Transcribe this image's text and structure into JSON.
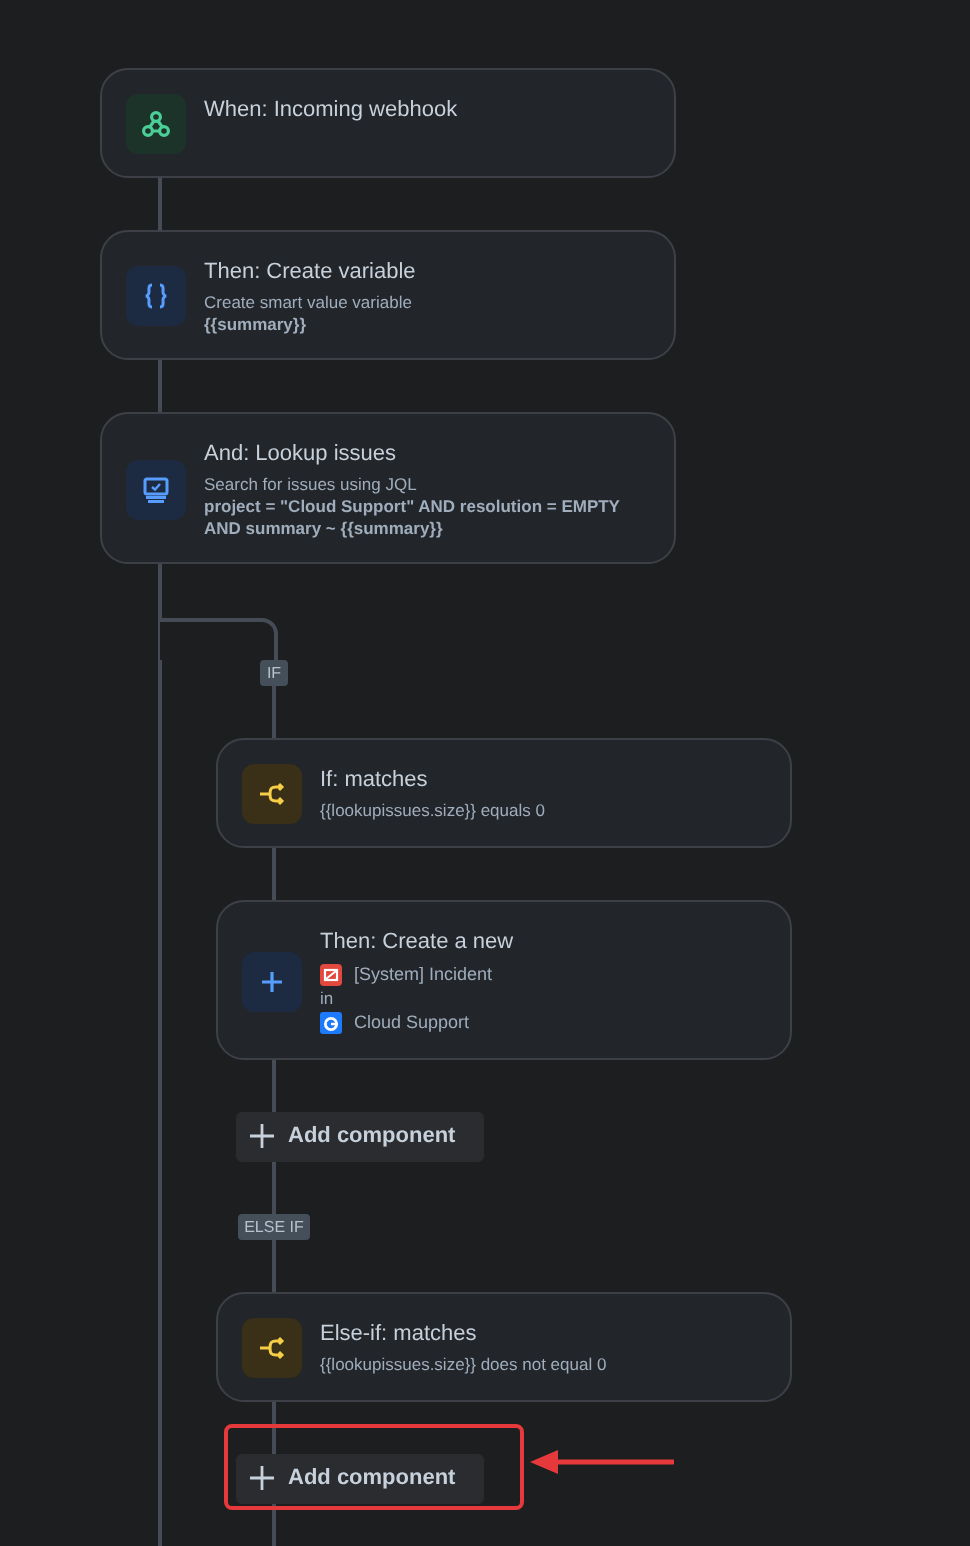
{
  "steps": [
    {
      "kind": "trigger",
      "title": "When: Incoming webhook"
    },
    {
      "kind": "variable",
      "title": "Then: Create variable",
      "lines": [
        {
          "kind": "plain",
          "text": "Create smart value variable"
        },
        {
          "kind": "value",
          "text": "{{summary}}"
        }
      ]
    },
    {
      "kind": "lookup",
      "title": "And: Lookup issues",
      "lines": [
        {
          "kind": "plain",
          "text": "Search for issues using JQL"
        },
        {
          "kind": "value",
          "text": "project = \"Cloud Support\" AND resolution = EMPTY AND summary ~ {{summary}}"
        }
      ]
    }
  ],
  "branch": [
    {
      "kind": "tag",
      "text": "IF"
    },
    {
      "kind": "condition",
      "title": "If: matches",
      "lines": [
        {
          "kind": "plain",
          "text": "{{lookupissues.size}} equals 0"
        }
      ]
    },
    {
      "kind": "create",
      "title": "Then: Create a new",
      "lines": [
        {
          "kind": "issue-type",
          "text": "[System] Incident"
        },
        {
          "kind": "plain",
          "text": "in"
        },
        {
          "kind": "project",
          "text": "Cloud Support"
        }
      ]
    },
    {
      "kind": "add",
      "label": "Add component",
      "highlighted": false
    },
    {
      "kind": "tag",
      "text": "ELSE IF"
    },
    {
      "kind": "condition",
      "title": "Else-if: matches",
      "lines": [
        {
          "kind": "plain",
          "text": "{{lookupissues.size}} does not equal 0"
        }
      ]
    },
    {
      "kind": "add",
      "label": "Add component",
      "highlighted": true
    }
  ]
}
